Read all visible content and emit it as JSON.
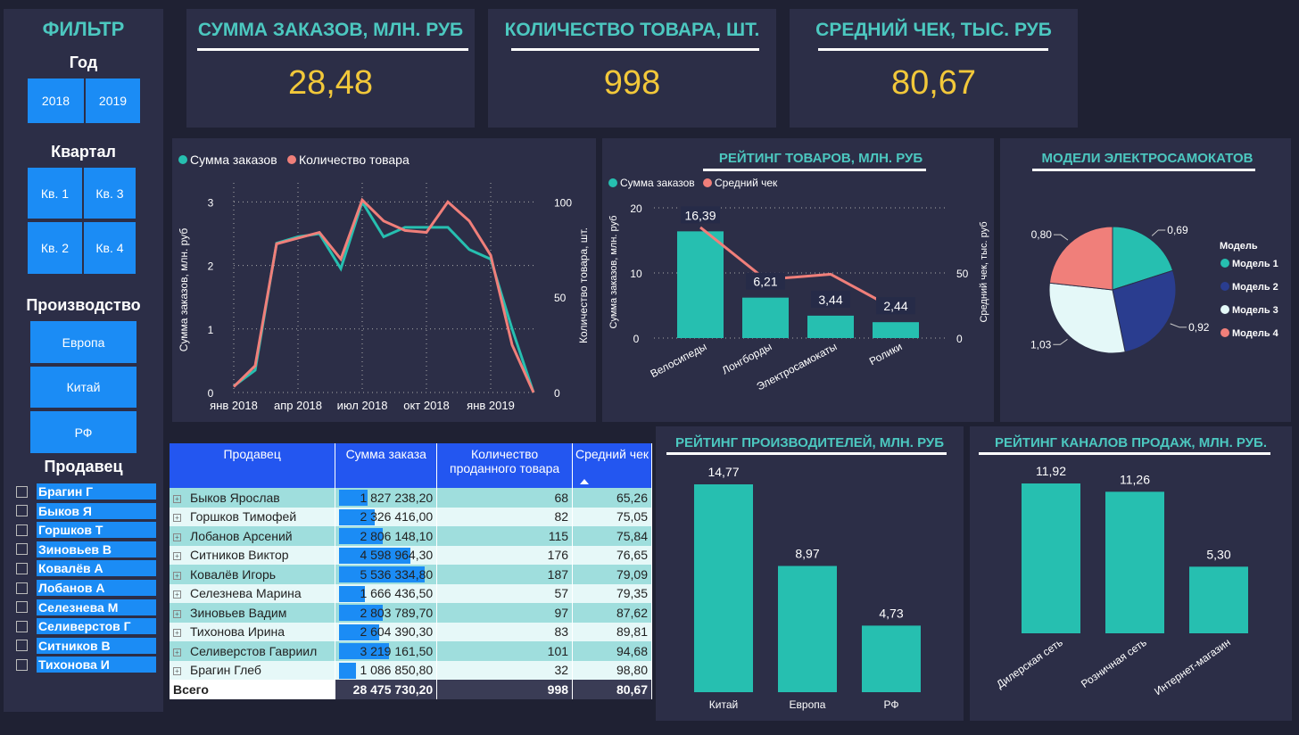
{
  "filter": {
    "title": "ФИЛЬТР",
    "year_label": "Год",
    "years": [
      "2018",
      "2019"
    ],
    "quarter_label": "Квартал",
    "quarters": [
      "Кв. 1",
      "Кв. 3",
      "Кв. 2",
      "Кв. 4"
    ],
    "production_label": "Производство",
    "productions": [
      "Европа",
      "Китай",
      "РФ"
    ],
    "seller_label": "Продавец",
    "sellers": [
      "Брагин Г",
      "Быков Я",
      "Горшков Т",
      "Зиновьев В",
      "Ковалёв А",
      "Лобанов А",
      "Селезнева М",
      "Селиверстов Г",
      "Ситников В",
      "Тихонова И"
    ]
  },
  "kpis": [
    {
      "title": "СУММА ЗАКАЗОВ, МЛН. РУБ",
      "value": "28,48"
    },
    {
      "title": "КОЛИЧЕСТВО ТОВАРА, ШТ.",
      "value": "998"
    },
    {
      "title": "СРЕДНИЙ ЧЕК,  ТЫС. РУБ",
      "value": "80,67"
    }
  ],
  "colors": {
    "teal": "#26bfb0",
    "salmon": "#f07f7a",
    "navy": "#2a3d8f",
    "ice": "#e4f8f8",
    "blue": "#1b8cf5",
    "gold": "#f2c83a"
  },
  "chart_data": [
    {
      "type": "line",
      "legend": [
        "Сумма заказов",
        "Количество товара"
      ],
      "ylabel": "Сумма заказов, млн. руб",
      "y2label": "Количество товара, шт.",
      "x_ticks": [
        "янв 2018",
        "апр 2018",
        "июл 2018",
        "окт 2018",
        "янв 2019"
      ],
      "y_ticks": [
        "0",
        "1",
        "2",
        "3"
      ],
      "y2_ticks": [
        "0",
        "50",
        "100"
      ],
      "ylim": [
        0,
        3.3
      ],
      "y2lim": [
        0,
        110
      ],
      "series": [
        {
          "name": "Сумма заказов",
          "axis": "left",
          "values": [
            0.1,
            0.35,
            2.35,
            2.45,
            2.5,
            1.95,
            3.0,
            2.45,
            2.6,
            2.6,
            2.6,
            2.25,
            2.1,
            1.0,
            0.0
          ]
        },
        {
          "name": "Количество товара",
          "axis": "right",
          "values": [
            3,
            14,
            78,
            81,
            84,
            70,
            101,
            90,
            85,
            84,
            100,
            90,
            72,
            25,
            0
          ]
        }
      ]
    },
    {
      "type": "bar",
      "title": "РЕЙТИНГ ТОВАРОВ, МЛН. РУБ",
      "legend": [
        "Сумма заказов",
        "Средний чек"
      ],
      "ylabel": "Сумма заказов, млн. руб",
      "y2label": "Средний чек, тыс. руб",
      "categories": [
        "Велосипеды",
        "Лонгборды",
        "Электросамокаты",
        "Ролики"
      ],
      "y_ticks": [
        "0",
        "10",
        "20"
      ],
      "y2_ticks": [
        "0",
        "50"
      ],
      "ylim": [
        0,
        20
      ],
      "y2lim": [
        0,
        100
      ],
      "series": [
        {
          "name": "Сумма заказов",
          "values": [
            16.39,
            6.21,
            3.44,
            2.44
          ],
          "labels": [
            "16,39",
            "6,21",
            "3,44",
            "2,44"
          ]
        },
        {
          "name": "Средний чек",
          "type": "line",
          "values": [
            85,
            45,
            49,
            22
          ]
        }
      ]
    },
    {
      "type": "pie",
      "title": "МОДЕЛИ ЭЛЕКТРОСАМОКАТОВ",
      "legend_title": "Модель",
      "slices": [
        {
          "name": "Модель 1",
          "value": 0.69,
          "label": "0,69",
          "color": "#26bfb0"
        },
        {
          "name": "Модель 2",
          "value": 0.92,
          "label": "0,92",
          "color": "#2a3d8f"
        },
        {
          "name": "Модель 3",
          "value": 1.03,
          "label": "1,03",
          "color": "#e4f8f8"
        },
        {
          "name": "Модель 4",
          "value": 0.8,
          "label": "0,80",
          "color": "#f07f7a"
        }
      ]
    },
    {
      "type": "bar",
      "title": "РЕЙТИНГ ПРОИЗВОДИТЕЛЕЙ, МЛН. РУБ",
      "categories": [
        "Китай",
        "Европа",
        "РФ"
      ],
      "values": [
        14.77,
        8.97,
        4.73
      ],
      "labels": [
        "14,77",
        "8,97",
        "4,73"
      ]
    },
    {
      "type": "bar",
      "title": "РЕЙТИНГ КАНАЛОВ ПРОДАЖ, МЛН. РУБ.",
      "categories": [
        "Дилерская сеть",
        "Розничная сеть",
        "Интернет-магазин"
      ],
      "values": [
        11.92,
        11.26,
        5.3
      ],
      "labels": [
        "11,92",
        "11,26",
        "5,30"
      ]
    },
    {
      "type": "table",
      "columns": [
        "Продавец",
        "Сумма заказа",
        "Количество проданного товара",
        "Средний чек"
      ],
      "rows": [
        {
          "seller": "Быков Ярослав",
          "sum": "1 827 238,20",
          "sum_value": 1827238.2,
          "qty": "68",
          "avg": "65,26"
        },
        {
          "seller": "Горшков Тимофей",
          "sum": "2 326 416,00",
          "sum_value": 2326416.0,
          "qty": "82",
          "avg": "75,05"
        },
        {
          "seller": "Лобанов Арсений",
          "sum": "2 806 148,10",
          "sum_value": 2806148.1,
          "qty": "115",
          "avg": "75,84"
        },
        {
          "seller": "Ситников Виктор",
          "sum": "4 598 964,30",
          "sum_value": 4598964.3,
          "qty": "176",
          "avg": "76,65"
        },
        {
          "seller": "Ковалёв Игорь",
          "sum": "5 536 334,80",
          "sum_value": 5536334.8,
          "qty": "187",
          "avg": "79,09"
        },
        {
          "seller": "Селезнева Марина",
          "sum": "1 666 436,50",
          "sum_value": 1666436.5,
          "qty": "57",
          "avg": "79,35"
        },
        {
          "seller": "Зиновьев Вадим",
          "sum": "2 803 789,70",
          "sum_value": 2803789.7,
          "qty": "97",
          "avg": "87,62"
        },
        {
          "seller": "Тихонова Ирина",
          "sum": "2 604 390,30",
          "sum_value": 2604390.3,
          "qty": "83",
          "avg": "89,81"
        },
        {
          "seller": "Селиверстов Гавриил",
          "sum": "3 219 161,50",
          "sum_value": 3219161.5,
          "qty": "101",
          "avg": "94,68"
        },
        {
          "seller": "Брагин Глеб",
          "sum": "1 086 850,80",
          "sum_value": 1086850.8,
          "qty": "32",
          "avg": "98,80"
        }
      ],
      "total": {
        "label": "Всего",
        "sum": "28 475 730,20",
        "qty": "998",
        "avg": "80,67"
      }
    }
  ]
}
